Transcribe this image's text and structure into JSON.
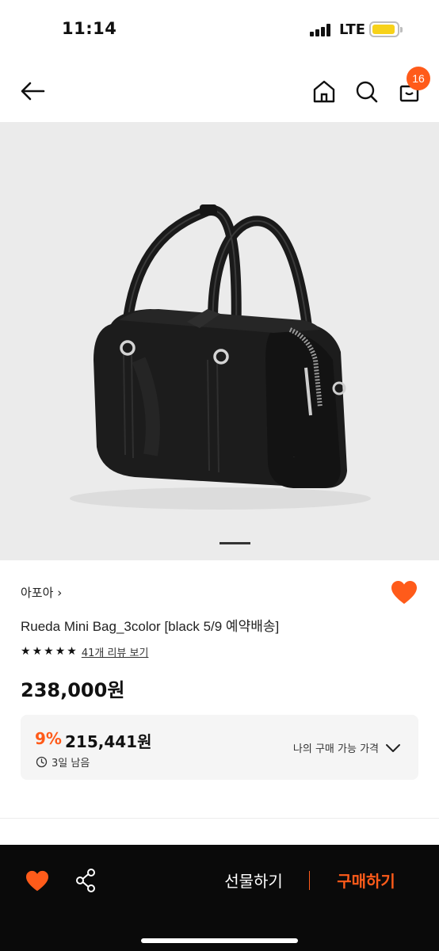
{
  "status_bar": {
    "time": "11:14",
    "network": "LTE"
  },
  "header": {
    "cart_count": "16"
  },
  "product": {
    "brand": "아포아",
    "brand_chevron": "›",
    "name": "Rueda Mini Bag_3color [black 5/9 예약배송]",
    "rating_stars": 5,
    "review_link": "41개 리뷰 보기",
    "price": "238,000원",
    "image_page": {
      "current": 1
    }
  },
  "benefit": {
    "discount_rate": "9%",
    "discounted_price": "215,441원",
    "time_left": "3일 남음",
    "my_price_label": "나의 구매 가능 가격"
  },
  "bottom_bar": {
    "gift_label": "선물하기",
    "buy_label": "구매하기"
  },
  "colors": {
    "accent": "#ff5b1a",
    "bottom_bar_bg": "#0a0a0a",
    "image_bg": "#ebebeb",
    "battery": "#f7d21a"
  },
  "icons": {
    "back": "arrow-left-icon",
    "home": "home-icon",
    "search": "search-icon",
    "cart": "shopping-bag-icon",
    "wish": "heart-icon",
    "share": "share-icon",
    "clock": "clock-icon",
    "chevron": "chevron-down-icon"
  }
}
